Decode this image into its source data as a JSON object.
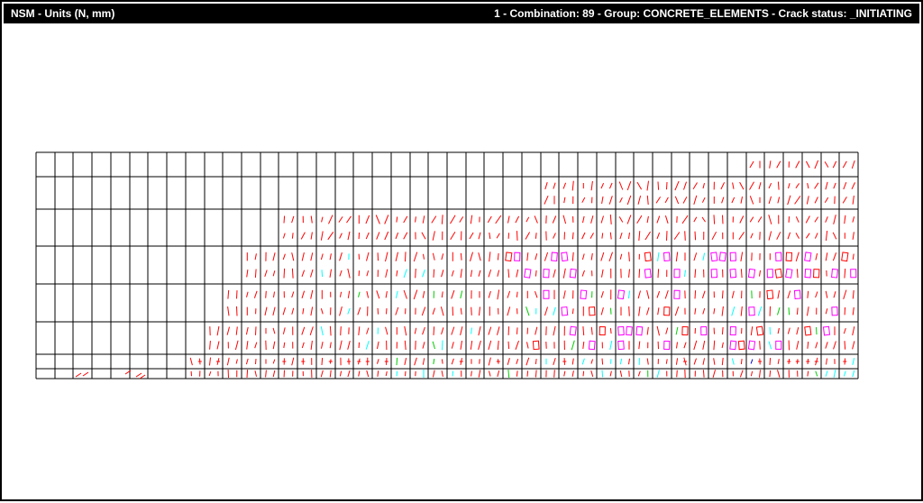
{
  "header": {
    "left_title": "NSM - Units (N, mm)",
    "right_title": "1 - Combination: 89 - Group: CONCRETE_ELEMENTS - Crack status: _INITIATING"
  },
  "colors": {
    "mesh_line": "#000000",
    "crack_primary": "#ff0000",
    "crack_secondary": "#00ffff",
    "crack_tertiary": "#00cc00",
    "crack_open_box": "#ff00ff",
    "crack_deep": "#0000cc"
  }
}
